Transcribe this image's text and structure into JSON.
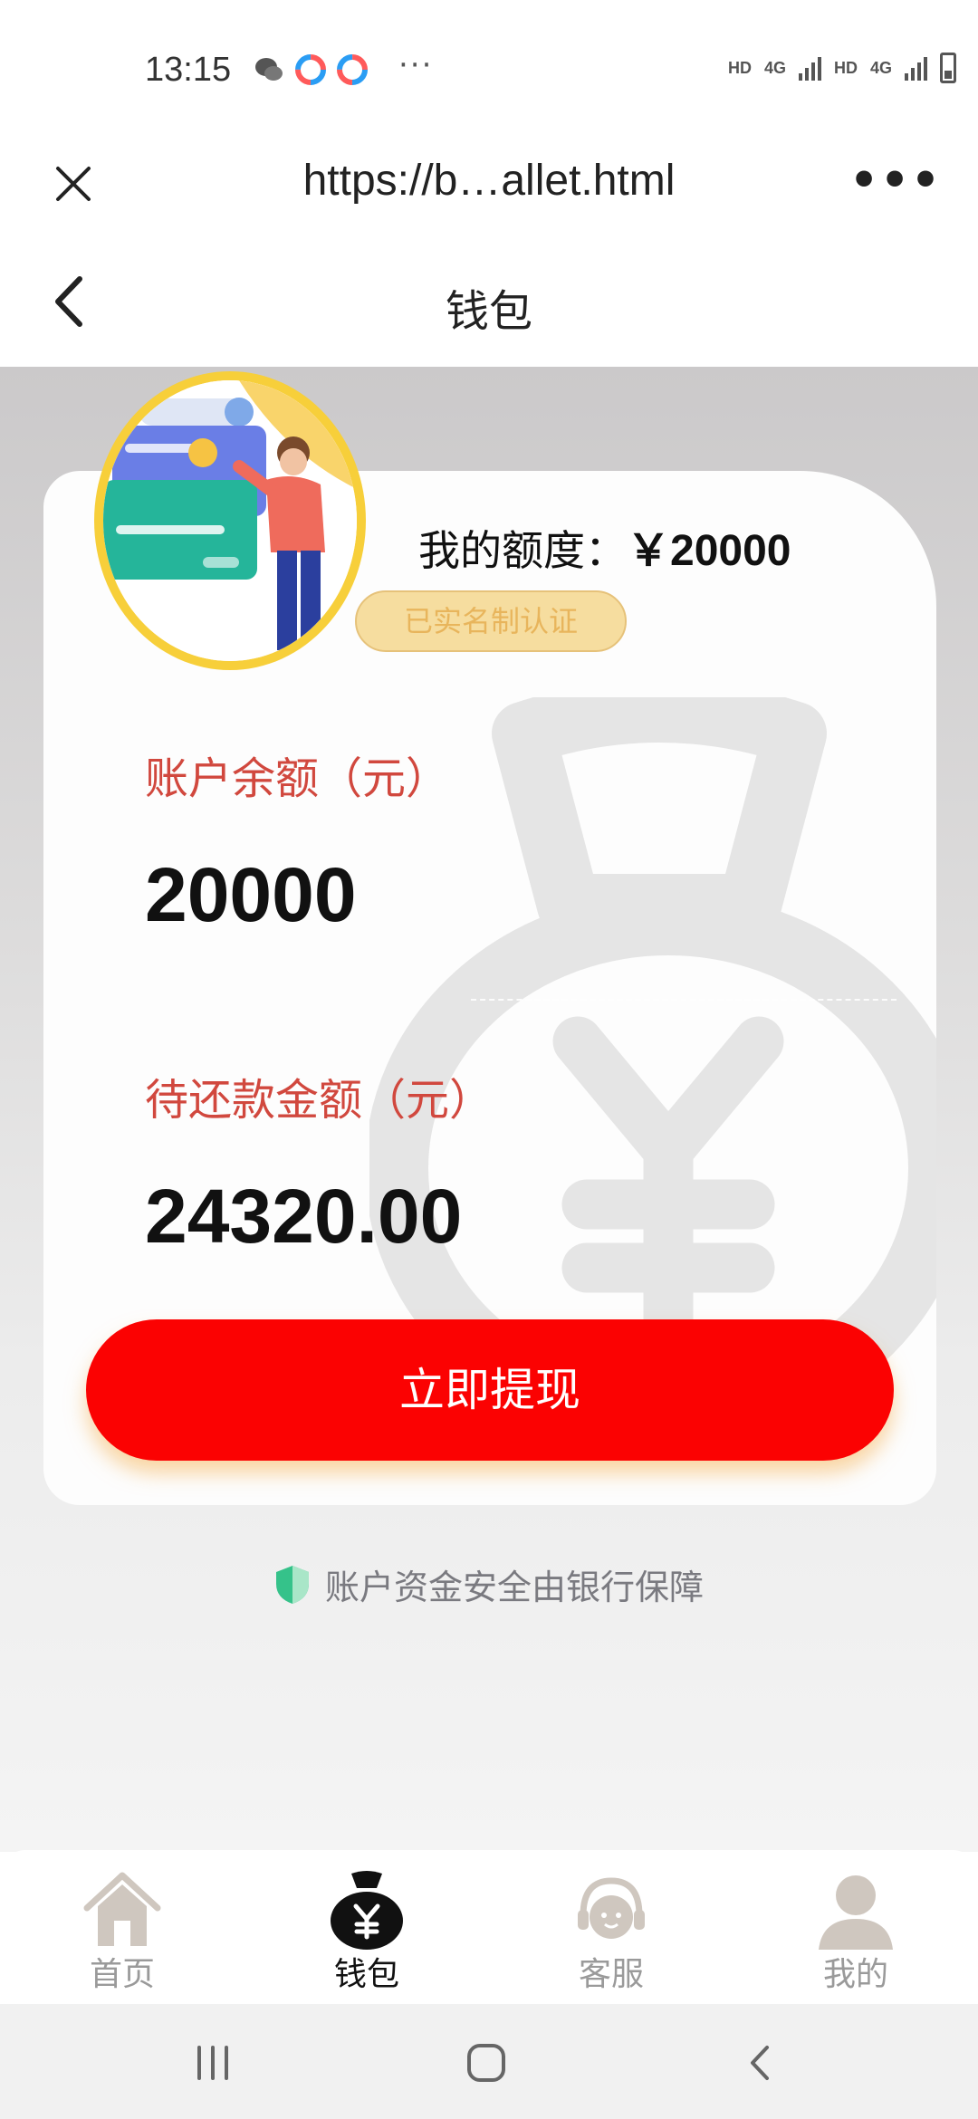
{
  "status_bar": {
    "time": "13:15",
    "dots": "···",
    "hd1": "HD",
    "net1": "4G",
    "hd2": "HD",
    "net2": "4G"
  },
  "browser": {
    "url": "https://b…allet.html",
    "menu": "•••"
  },
  "header": {
    "title": "钱包"
  },
  "wallet": {
    "quota_label": "我的额度：",
    "quota_amount": "￥20000",
    "verified": "已实名制认证",
    "balance_label": "账户余额（元）",
    "balance_value": "20000",
    "repay_label": "待还款金额（元）",
    "repay_value": "24320.00",
    "withdraw_button": "立即提现",
    "security_note": "账户资金安全由银行保障"
  },
  "tabs": [
    {
      "label": "首页",
      "icon": "home-icon"
    },
    {
      "label": "钱包",
      "icon": "wallet-bag-icon"
    },
    {
      "label": "客服",
      "icon": "customer-service-icon"
    },
    {
      "label": "我的",
      "icon": "profile-icon"
    }
  ],
  "colors": {
    "accent_red": "#fb0202",
    "label_red": "#d1483e",
    "badge_gold": "#f6dd9f"
  }
}
